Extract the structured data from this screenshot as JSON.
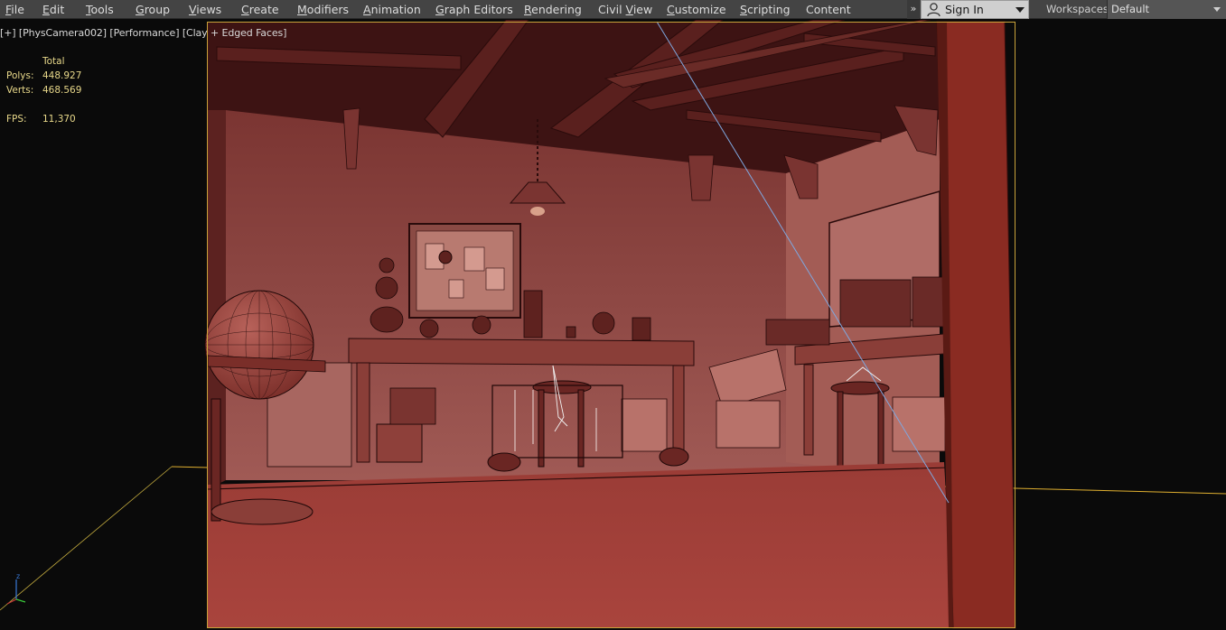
{
  "menubar": {
    "items": [
      {
        "pre": "",
        "ul": "F",
        "post": "ile"
      },
      {
        "pre": "",
        "ul": "E",
        "post": "dit"
      },
      {
        "pre": "",
        "ul": "T",
        "post": "ools"
      },
      {
        "pre": "",
        "ul": "G",
        "post": "roup"
      },
      {
        "pre": "",
        "ul": "V",
        "post": "iews"
      },
      {
        "pre": "",
        "ul": "C",
        "post": "reate"
      },
      {
        "pre": "",
        "ul": "M",
        "post": "odifiers"
      },
      {
        "pre": "",
        "ul": "A",
        "post": "nimation"
      },
      {
        "pre": "",
        "ul": "G",
        "post": "raph Editors"
      },
      {
        "pre": "",
        "ul": "R",
        "post": "endering"
      },
      {
        "pre": "Civil ",
        "ul": "V",
        "post": "iew"
      },
      {
        "pre": "",
        "ul": "C",
        "post": "ustomize"
      },
      {
        "pre": "",
        "ul": "S",
        "post": "cripting"
      },
      {
        "pre": "",
        "ul": "",
        "post": "Content"
      }
    ],
    "overflow_glyph": "»",
    "signin_label": "Sign In",
    "workspaces_label": "Workspaces:",
    "workspace_value": "Default"
  },
  "viewport": {
    "label_parts": {
      "a": "[+]",
      "b": "[PhysCamera002]",
      "c": "[Performance]",
      "d": "[Clay + Edged Faces]"
    },
    "stats": {
      "header": "Total",
      "polys_label": "Polys:",
      "polys_value": "448.927",
      "verts_label": "Verts:",
      "verts_value": "468.569",
      "fps_label": "FPS:",
      "fps_value": "11,370"
    },
    "gizmo_axis_label": "z"
  },
  "colors": {
    "menubar_bg": "#444444",
    "menu_text": "#dcdcdc",
    "viewport_bg": "#0a0a0a",
    "stats_text": "#e8d88a",
    "clay_dark": "#4a1614",
    "clay_mid": "#8a3a33",
    "clay_light": "#b0504a",
    "frame_border": "#c9a23a",
    "camera_line_blue": "#7fa8e0",
    "grid_line_yellow": "#e0b030"
  },
  "icons": {
    "signin": "user-icon",
    "signin_caret": "chevron-down-icon",
    "workspace_caret": "chevron-down-icon",
    "overflow": "chevron-double-right-icon",
    "gizmo": "axis-gizmo-icon"
  }
}
